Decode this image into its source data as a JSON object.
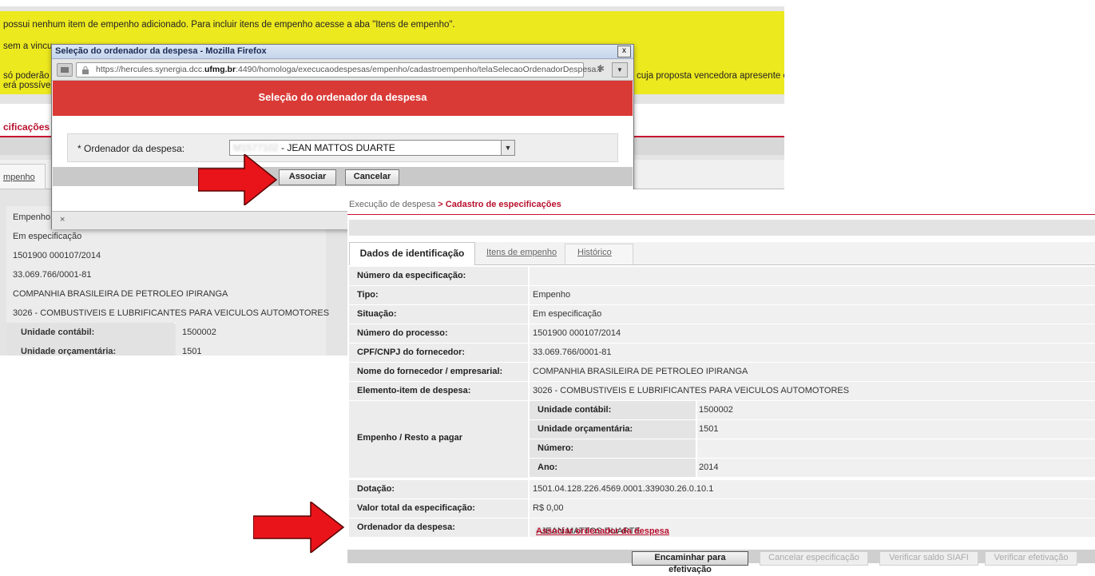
{
  "background": {
    "yellow_lines": [
      "possui nenhum item de empenho adicionado. Para incluir itens de empenho acesse a aba \"Itens de empenho\".",
      "sem a vincu",
      "só poderão",
      "erá possíve"
    ],
    "yellow_right_text": "cuja proposta vencedora apresente o",
    "tab_label": "cificações",
    "emp_tab": "mpenho",
    "rows": [
      "Empenho",
      "Em especificação",
      "1501900 000107/2014",
      "33.069.766/0001-81",
      "COMPANHIA BRASILEIRA DE PETROLEO IPIRANGA",
      "3026 - COMBUSTIVEIS E LUBRIFICANTES PARA VEICULOS AUTOMOTORES"
    ],
    "sub_rows": [
      {
        "label": "Unidade contábil:",
        "value": "1500002"
      },
      {
        "label": "Unidade orçamentária:",
        "value": "1501"
      }
    ]
  },
  "popup": {
    "title": "Seleção do ordenador da despesa - Mozilla Firefox",
    "close": "x",
    "url_prefix": "https://hercules.synergia.dcc.",
    "url_host": "ufmg.br",
    "url_suffix": ":4490/homologa/execucaodespesas/empenho/cadastroempenho/telaSelecaoOrdenadorDespesa.l",
    "header": "Seleção do ordenador da despesa",
    "field_label": "* Ordenador da despesa:",
    "field_value_blurred": "M1577102",
    "field_value": " - JEAN MATTOS DUARTE",
    "btn_associar": "Associar",
    "btn_cancelar": "Cancelar",
    "footer_x": "×"
  },
  "front": {
    "breadcrumb_prefix": "Execução de despesa",
    "breadcrumb_sep": " > ",
    "breadcrumb_current": "Cadastro de especificações",
    "tabs": [
      "Dados de identificação",
      "Itens de empenho",
      "Histórico"
    ],
    "rows": [
      {
        "label": "Número da especificação:",
        "value": ""
      },
      {
        "label": "Tipo:",
        "value": "Empenho"
      },
      {
        "label": "Situação:",
        "value": "Em especificação"
      },
      {
        "label": "Número do processo:",
        "value": "1501900 000107/2014"
      },
      {
        "label": "CPF/CNPJ do fornecedor:",
        "value": "33.069.766/0001-81"
      },
      {
        "label": "Nome do fornecedor / empresarial:",
        "value": "COMPANHIA BRASILEIRA DE PETROLEO IPIRANGA"
      },
      {
        "label": "Elemento-item de despesa:",
        "value": "3026 - COMBUSTIVEIS E LUBRIFICANTES PARA VEICULOS AUTOMOTORES"
      }
    ],
    "empenho_label": "Empenho / Resto a pagar",
    "empenho_sub": [
      {
        "label": "Unidade contábil:",
        "value": "1500002"
      },
      {
        "label": "Unidade orçamentária:",
        "value": "1501"
      },
      {
        "label": "Número:",
        "value": ""
      },
      {
        "label": "Ano:",
        "value": "2014"
      }
    ],
    "dotacao": {
      "label": "Dotação:",
      "value": "1501.04.128.226.4569.0001.339030.26.0.10.1"
    },
    "valor": {
      "label": "Valor total da especificação:",
      "value": "R$ 0,00"
    },
    "ordenador": {
      "label": "Ordenador da despesa:",
      "value_blurred": "M1577102",
      "value": " - JEAN MATTOS DUARTE",
      "link": "Associar ordenador da despesa"
    },
    "bottom_buttons": [
      "Encaminhar para efetivação",
      "Cancelar especificação",
      "Verificar saldo SIAFI",
      "Verificar efetivação"
    ]
  },
  "colors": {
    "accent_red": "#c8102e",
    "popup_header_red": "#d93a36",
    "warning_yellow": "#ede91f",
    "arrow_red": "#e8141a"
  }
}
